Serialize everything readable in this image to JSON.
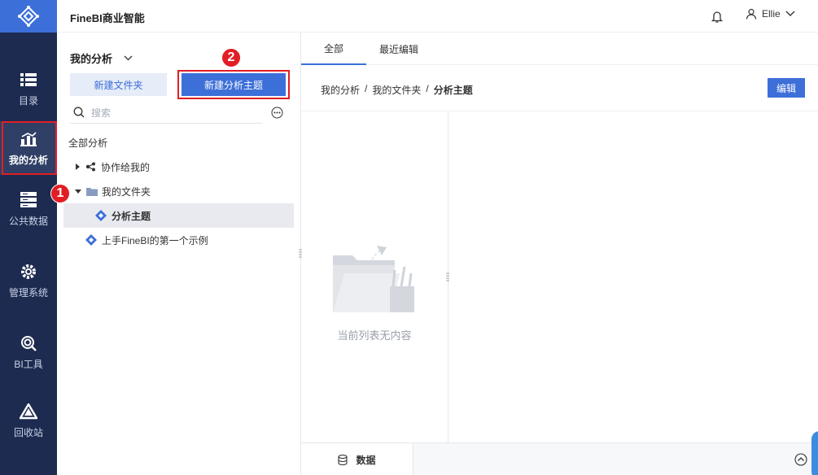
{
  "app": {
    "title": "FineBI商业智能"
  },
  "topbar": {
    "user_name": "Ellie"
  },
  "rail": {
    "items": [
      {
        "label": "目录",
        "icon": "list-icon"
      },
      {
        "label": "我的分析",
        "icon": "chart-icon"
      },
      {
        "label": "公共数据",
        "icon": "database-icon"
      },
      {
        "label": "管理系统",
        "icon": "gear-icon"
      },
      {
        "label": "BI工具",
        "icon": "tool-icon"
      },
      {
        "label": "回收站",
        "icon": "recycle-icon"
      }
    ]
  },
  "panel": {
    "title": "我的分析",
    "new_folder_label": "新建文件夹",
    "new_topic_label": "新建分析主题",
    "search_placeholder": "搜索",
    "tree_head": "全部分析",
    "tree": [
      {
        "label": "协作给我的"
      },
      {
        "label": "我的文件夹"
      },
      {
        "label": "分析主题"
      },
      {
        "label": "上手FineBI的第一个示例"
      }
    ]
  },
  "badges": {
    "one": "1",
    "two": "2"
  },
  "tabs": [
    {
      "label": "全部"
    },
    {
      "label": "最近编辑"
    }
  ],
  "breadcrumb": {
    "items": [
      "我的分析",
      "我的文件夹"
    ],
    "current": "分析主题",
    "sep": "/"
  },
  "edit_label": "编辑",
  "empty_text": "当前列表无内容",
  "bottom": {
    "data_label": "数据"
  },
  "colors": {
    "accent": "#3d6fd9",
    "rail": "#1d2b50",
    "highlight": "#e21e25"
  }
}
